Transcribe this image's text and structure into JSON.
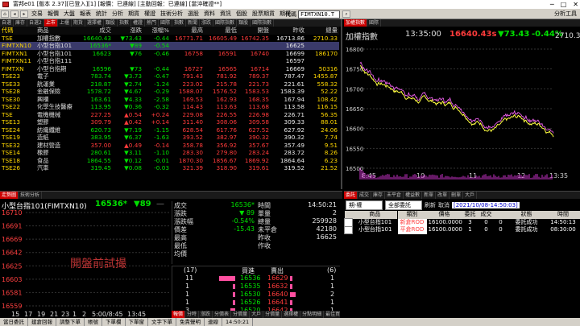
{
  "titlebar": {
    "title": "富邦e01 [版本 2.37][已登入][1] [報價：已連線] [主動回報：已連線] [當沖確證**]",
    "min": "─",
    "max": "□",
    "close": "✕"
  },
  "menu": [
    "交易",
    "報價",
    "大盤",
    "報表",
    "統計",
    "分析",
    "期貨",
    "權證",
    "技術分析",
    "選股",
    "資料",
    "資訊",
    "個股",
    "股票期貨",
    "期權"
  ],
  "toolbar": {
    "symbol_label": "代碼",
    "symbol_value": "FIMTXN10.T",
    "analysis": "分析工具"
  },
  "quote_tabs": [
    "自選",
    "庫存",
    "自選2",
    "上市",
    "上櫃",
    "期貨",
    "選擇權",
    "類股",
    "指數",
    "權證",
    "熱門",
    "國際",
    "指數",
    "新聞",
    "漲跌",
    "國際指數",
    "類股",
    "國際指數"
  ],
  "quote_headers": [
    "代碼",
    "商品",
    "成交",
    "漲跌",
    "漲幅%",
    "最高",
    "最低",
    "開盤",
    "昨收",
    "總量"
  ],
  "quote_rows": [
    [
      "TSE",
      "加權指數",
      "16640.43",
      "▼73.43",
      "-0.44",
      "16771.71",
      "16605.49",
      "16742.35",
      "16713.86",
      "2710.33"
    ],
    [
      "FIMTXN10",
      "小型台指101",
      "16536*",
      "▼89",
      "-0.54",
      "",
      "",
      "",
      "16625",
      ""
    ],
    [
      "FIMTXN1",
      "小型台指101",
      "16623",
      "▼76",
      "-0.46",
      "16758",
      "16591",
      "16740",
      "16699",
      "186170"
    ],
    [
      "FIMTXN11",
      "小型台指111",
      "",
      "",
      "",
      "",
      "",
      "",
      "16597",
      ""
    ],
    [
      "FIMTXN",
      "小型台指期",
      "16596",
      "▼73",
      "-0.44",
      "16727",
      "16565",
      "16714",
      "16669",
      "50316"
    ],
    [
      "TSE23",
      "電子",
      "783.74",
      "▼3.73",
      "-0.47",
      "791.43",
      "781.92",
      "789.37",
      "787.47",
      "1455.87"
    ],
    [
      "TSE33",
      "航運業",
      "218.87",
      "▼2.74",
      "-1.24",
      "223.02",
      "215.78",
      "221.73",
      "221.61",
      "558.32"
    ],
    [
      "TSE28",
      "金融保險",
      "1578.72",
      "▼4.67",
      "-0.29",
      "1588.07",
      "1576.52",
      "1583.53",
      "1583.39",
      "52.22"
    ],
    [
      "TSE30",
      "興櫃",
      "163.61",
      "▼4.33",
      "-2.58",
      "169.53",
      "162.93",
      "168.35",
      "167.94",
      "108.42"
    ],
    [
      "TSE22",
      "化學生技醫療",
      "113.95",
      "▼0.36",
      "-0.32",
      "114.43",
      "113.63",
      "113.68",
      "113.58",
      "116.15"
    ],
    [
      "TSE",
      "電機機械",
      "227.25",
      "▲0.54",
      "+0.24",
      "229.08",
      "226.55",
      "226.98",
      "226.71",
      "56.35"
    ],
    [
      "TSE13",
      "塑膠",
      "309.79",
      "▲0.42",
      "+0.14",
      "311.40",
      "308.06",
      "309.58",
      "309.33",
      "88.01"
    ],
    [
      "TSE24",
      "紡織纖維",
      "620.73",
      "▼7.19",
      "-1.15",
      "628.54",
      "617.76",
      "627.52",
      "627.92",
      "24.06"
    ],
    [
      "TSE19",
      "造紙",
      "383.95",
      "▼6.37",
      "-1.63",
      "393.52",
      "382.97",
      "390.32",
      "390.32",
      "7.74"
    ],
    [
      "TSE32",
      "建材營造",
      "357.00",
      "▲0.49",
      "-0.14",
      "358.78",
      "356.92",
      "357.67",
      "357.49",
      "9.51"
    ],
    [
      "TSE14",
      "橡膠",
      "280.61",
      "▼3.11",
      "-1.10",
      "283.30",
      "279.80",
      "283.24",
      "283.72",
      "8.26"
    ],
    [
      "TSE18",
      "食品",
      "1864.55",
      "▼0.12",
      "-0.01",
      "1870.30",
      "1856.67",
      "1869.92",
      "1864.64",
      "6.23"
    ],
    [
      "TSE26",
      "汽車",
      "319.45",
      "▼0.08",
      "-0.03",
      "321.39",
      "318.90",
      "319.61",
      "319.52",
      "21.52"
    ]
  ],
  "index_chart": {
    "tabs": [
      "加權指數",
      "國際"
    ],
    "title": "加權指數",
    "time": "13:35:00",
    "price": "16640.43s",
    "change": "▼73.43",
    "pct": "-0.44%",
    "volume": "2710.33億",
    "y_ticks": [
      "16800",
      "16750",
      "16700",
      "16650",
      "16600",
      "16550",
      "16500"
    ],
    "x_ticks": [
      "8:45",
      "10",
      "11",
      "12",
      "13:35"
    ]
  },
  "tick_panel": {
    "tabs": [
      "走勢圖",
      "技術分析"
    ],
    "title": "小型台指101(FIMTXN10)",
    "price": "16536*",
    "change": "▼89",
    "change_extra": "—",
    "y_ticks": [
      "16710",
      "16691",
      "16669",
      "16642",
      "16625",
      "16603",
      "16581",
      "16559"
    ],
    "x_ticks": [
      "15",
      "17",
      "19",
      "21",
      "23",
      "1",
      "2",
      "5:00/8:45",
      "13:45"
    ],
    "watermark": "開盤前試撮",
    "fields_left": [
      [
        "成交",
        "16536*"
      ],
      [
        "漲跌",
        "▼ 89"
      ],
      [
        "漲跌幅",
        "-0.54%"
      ],
      [
        "價差",
        "-15.43"
      ],
      [
        "最高",
        ""
      ],
      [
        "最低",
        ""
      ],
      [
        "均價",
        ""
      ]
    ],
    "fields_right": [
      [
        "時間",
        "14:50:21"
      ],
      [
        "單量",
        "2"
      ],
      [
        "總量",
        "259928"
      ],
      [
        "未平倉",
        "42180"
      ],
      [
        "昨收",
        "16625"
      ],
      [
        "作收",
        ""
      ],
      [
        "",
        ""
      ]
    ],
    "buy_label": "買進",
    "sell_label": "賣出",
    "total_buy": "(17)",
    "total_sell": "(6)",
    "book": [
      {
        "bq": "11",
        "bp": "16536",
        "sp": "16629",
        "sq": "1",
        "bw": 20,
        "sw": 3
      },
      {
        "bq": "1",
        "bp": "16535",
        "sp": "16632",
        "sq": "1",
        "bw": 3,
        "sw": 3
      },
      {
        "bq": "1",
        "bp": "16530",
        "sp": "16640",
        "sq": "2",
        "bw": 3,
        "sw": 7
      },
      {
        "bq": "1",
        "bp": "16526",
        "sp": "16641",
        "sq": "1",
        "bw": 3,
        "sw": 3
      },
      {
        "bq": "3",
        "bp": "16520",
        "sp": "16642",
        "sq": "1",
        "bw": 6,
        "sw": 3
      }
    ],
    "bottom_tabs": [
      "報價",
      "分時",
      "漲跌",
      "分價表",
      "分價量",
      "大戶",
      "分價量",
      "選擇權",
      "分點明細",
      "最佳買賣"
    ]
  },
  "order_panel": {
    "tabs": [
      "委託",
      "成交",
      "庫存",
      "未平倉",
      "權益數",
      "新單",
      "改單",
      "刪單",
      "大戶"
    ],
    "account_select": "期-權",
    "filter_select": "全部委託",
    "btn_refresh": "刷新",
    "btn_cancel": "取消",
    "date_label": "[2021/10/08-14:50:03]",
    "headers": [
      "",
      "商品",
      "類別",
      "價格",
      "委託",
      "成交",
      "",
      "狀態",
      "時間"
    ],
    "rows": [
      [
        "",
        "小型台指101",
        "新倉ROD",
        "16100.0000",
        "3",
        "0",
        "0",
        "委託成功",
        "14:50:13"
      ],
      [
        "",
        "小型台指101",
        "平倉ROD",
        "16100.0000",
        "1",
        "0",
        "0",
        "委託成功",
        "08:30:00"
      ]
    ]
  },
  "statusbar": [
    "當日委託",
    "建倉回報",
    "調整下單",
    "帳號",
    "下單欄",
    "下單窗",
    "文字下單",
    "免責聲明",
    "連線",
    "14:50:21"
  ],
  "colors": {
    "up": "#ff3b3b",
    "down": "#00e000",
    "gold": "#ffd700",
    "cyan": "#00e5ff",
    "pink": "#ff4fa0"
  }
}
